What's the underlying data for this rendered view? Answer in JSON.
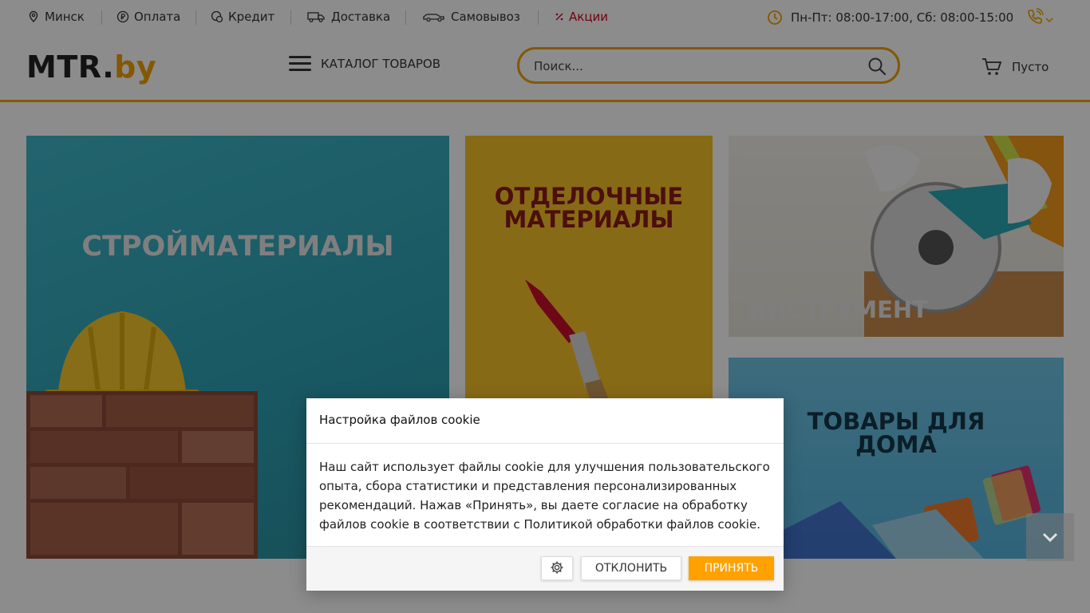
{
  "topbar": {
    "city": "Минск",
    "payment": "Оплата",
    "credit": "Кредит",
    "delivery": "Доставка",
    "pickup": "Самовывоз",
    "promo": "Акции",
    "hours": "Пн-Пт: 08:00-17:00, Сб: 08:00-15:00",
    "icons": [
      "location-icon",
      "ruble-icon",
      "credit-icon",
      "truck-icon",
      "car-icon",
      "percent-icon",
      "clock-icon",
      "phone-icon"
    ]
  },
  "header": {
    "logo_main": "MTR.",
    "logo_accent": "by",
    "catalog_label": "КАТАЛОГ ТОВАРОВ",
    "search_placeholder": "Поиск...",
    "cart_label": "Пусто"
  },
  "tiles": {
    "building": "СТРОЙМАТЕРИАЛЫ",
    "finishing_line1": "ОТДЕЛОЧНЫЕ",
    "finishing_line2": "МАТЕРИАЛЫ",
    "tools": "ИНСТРУМЕНТ",
    "home_line1": "ТОВАРЫ ДЛЯ",
    "home_line2": "ДОМА"
  },
  "cookie_modal": {
    "title": "Настройка файлов cookie",
    "body": "Наш сайт использует файлы cookie для улучшения пользовательского опыта, сбора статистики и представления персонализированных рекомендаций. Нажав «Принять», вы даете согласие на обработку файлов cookie в соответствии с Политикой обработки файлов cookie.",
    "decline_label": "ОТКЛОНИТЬ",
    "accept_label": "ПРИНЯТЬ"
  },
  "colors": {
    "accent": "#f0a000",
    "promo": "#d0021b",
    "accept_button": "#ffa200"
  }
}
